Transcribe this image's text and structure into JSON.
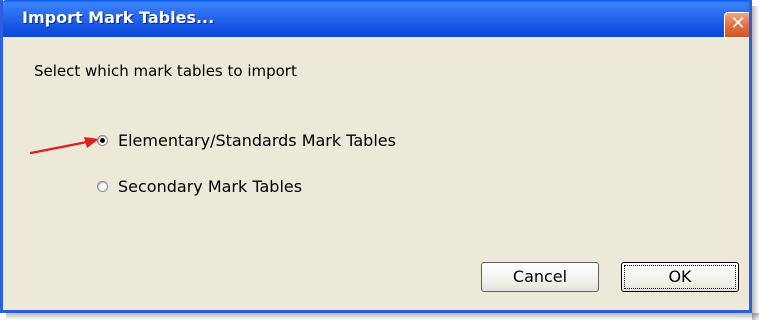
{
  "window": {
    "title": "Import Mark Tables...",
    "close_glyph": "✕",
    "colors": {
      "titlebar": "#2a6af0",
      "body": "#ece9d8",
      "close": "#e2703f",
      "arrow": "#e02020"
    }
  },
  "dialog": {
    "prompt": "Select which mark tables to import",
    "options": [
      {
        "label": "Elementary/Standards Mark Tables",
        "selected": true
      },
      {
        "label": "Secondary Mark Tables",
        "selected": false
      }
    ],
    "buttons": {
      "cancel": "Cancel",
      "ok": "OK"
    }
  },
  "annotation": {
    "icon": "red-arrow-icon"
  }
}
